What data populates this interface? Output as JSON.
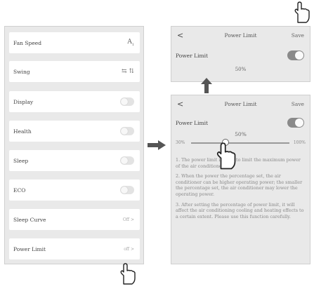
{
  "settings": {
    "rows": [
      {
        "label": "Fan Speed",
        "control": "fan-icon"
      },
      {
        "label": "Swing",
        "control": "swing-icons"
      },
      {
        "label": "Display",
        "control": "toggle-off"
      },
      {
        "label": "Health",
        "control": "toggle-off"
      },
      {
        "label": "Sleep",
        "control": "toggle-off"
      },
      {
        "label": "ECO",
        "control": "toggle-off"
      },
      {
        "label": "Sleep Curve",
        "value": "Off >"
      },
      {
        "label": "Power Limit",
        "value": "off >"
      }
    ]
  },
  "top_screen": {
    "title": "Power Limit",
    "save_label": "Save",
    "row_label": "Power Limit",
    "percent": "50%"
  },
  "bottom_screen": {
    "title": "Power Limit",
    "save_label": "Save",
    "row_label": "Power Limit",
    "percent": "50%",
    "slider": {
      "min_label": "30%",
      "max_label": "100%",
      "value": 0.35
    },
    "notes": [
      "1. The power limit is used to limit the maximum power of the air conditioner.",
      "2. When the power the percentage set, the air conditioner can be higher operating power; the smaller the percentage set, the air conditioner may lower the operating power.",
      "3. After setting the percentage of power limit, it will affect the air conditioning cooling and heating effects to a certain extent. Please use this function carefully."
    ]
  },
  "colors": {
    "panel": "#e9e9e9",
    "toggle_on": "#8a8a8a",
    "arrow": "#555555"
  }
}
